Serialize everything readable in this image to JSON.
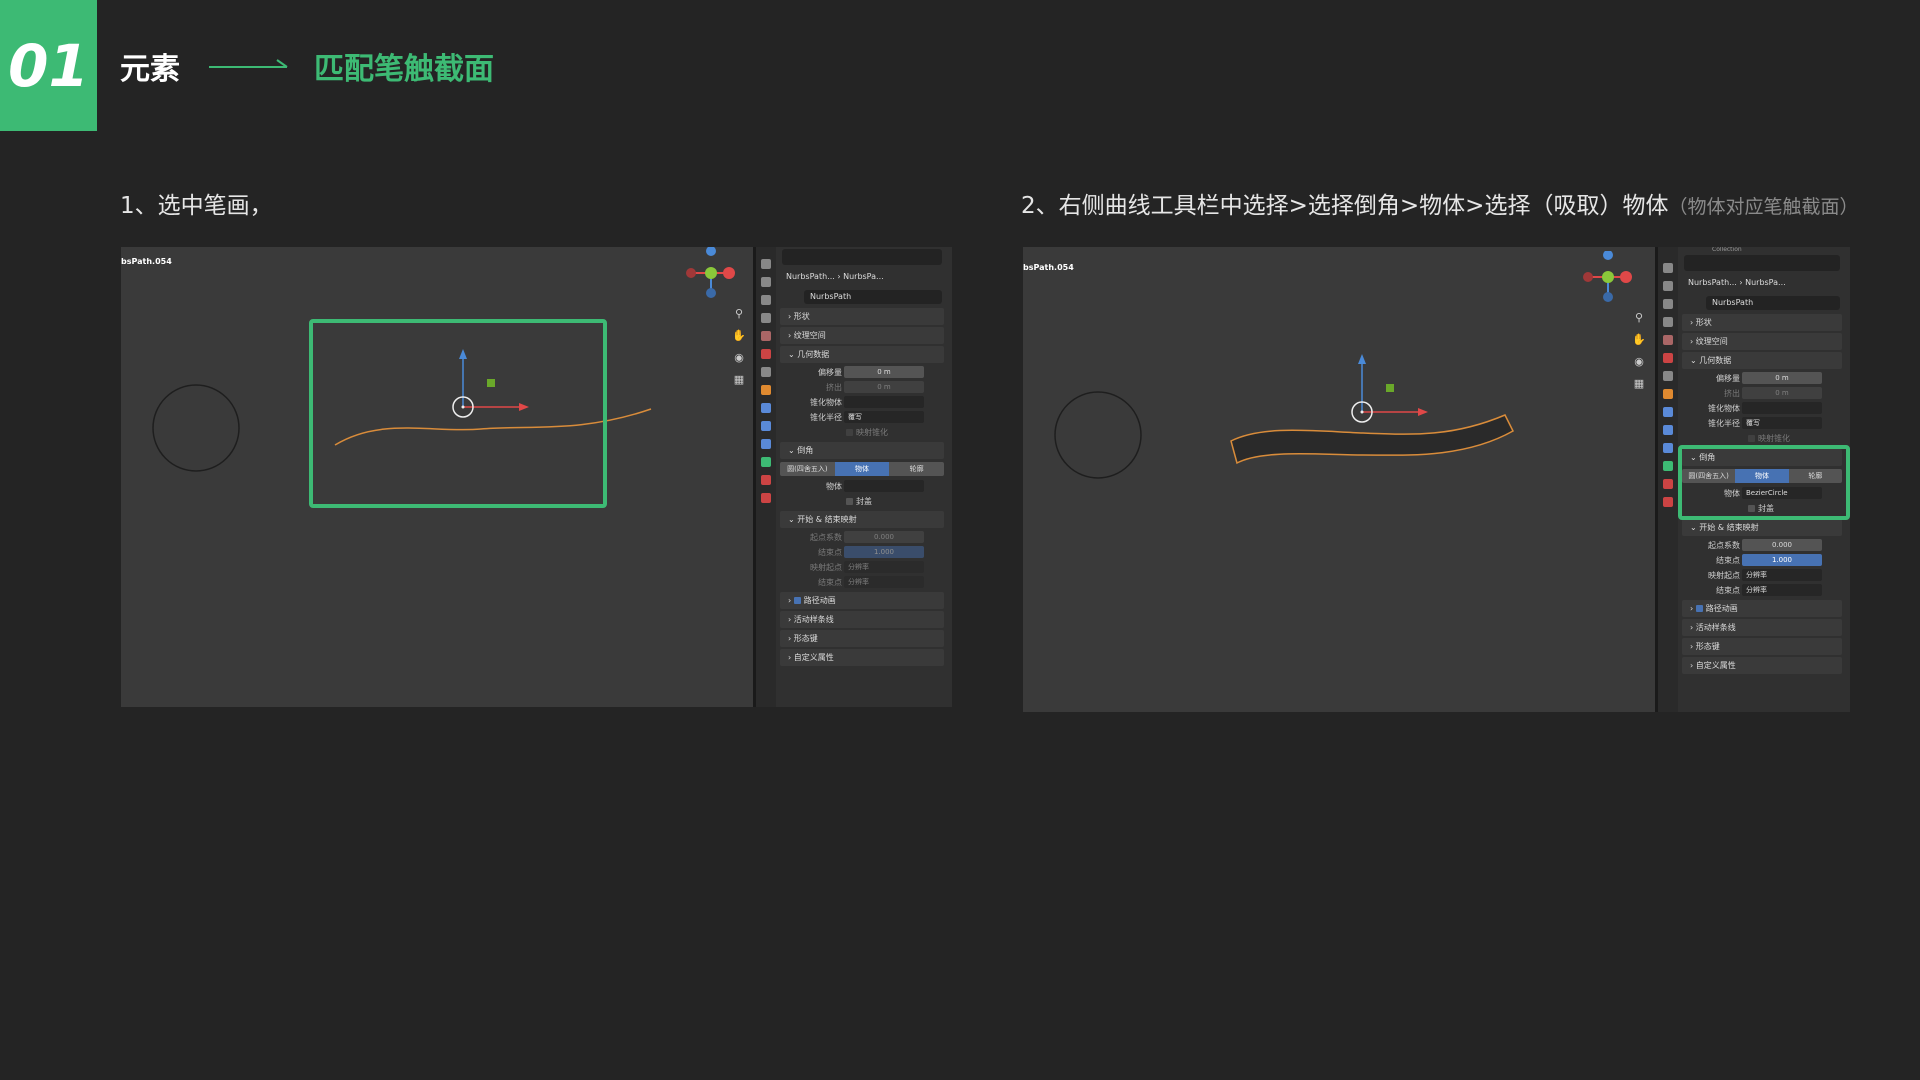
{
  "header": {
    "number": "01",
    "element_label": "元素",
    "topic": "匹配笔触截面"
  },
  "steps": {
    "step1": "1、选中笔画，",
    "step2_main": "2、右侧曲线工具栏中选择>选择倒角>物体>选择（吸取）物体",
    "step2_note": "（物体对应笔触截面）"
  },
  "shot1": {
    "object_name": "bsPath.054",
    "crumb_object": "NurbsPath...",
    "crumb_data": "NurbsPa...",
    "data_name": "NurbsPath",
    "sections": {
      "shape": "形状",
      "texture_space": "纹理空间",
      "geometry": "几何数据",
      "bevel": "倒角",
      "start_end": "开始 & 结束映射",
      "path_anim": "路径动画",
      "active_spline": "活动样条线",
      "shape_keys": "形态键",
      "custom_props": "自定义属性"
    },
    "geometry": {
      "offset_label": "偏移量",
      "offset_value": "0 m",
      "extrude_label": "挤出",
      "extrude_value": "0 m",
      "taper_label": "锥化物体",
      "taper_radius_label": "锥化半径",
      "taper_radius_value": "覆写",
      "map_taper": "映射锥化"
    },
    "bevel": {
      "mode_round": "圆(四舍五入)",
      "mode_object": "物体",
      "mode_profile": "轮廓",
      "object_label": "物体",
      "object_value": "",
      "fill_caps": "封盖"
    },
    "start_end": {
      "start_factor_label": "起点系数",
      "start_factor_value": "0.000",
      "end_factor_label": "结束点",
      "end_factor_value": "1.000",
      "mapping_start_label": "映射起点",
      "mapping_start_value": "分辨率",
      "mapping_end_label": "结束点",
      "mapping_end_value": "分辨率"
    }
  },
  "shot2": {
    "object_name": "bsPath.054",
    "collection_label": "Collection",
    "crumb_object": "NurbsPath...",
    "crumb_data": "NurbsPa...",
    "data_name": "NurbsPath",
    "sections": {
      "shape": "形状",
      "texture_space": "纹理空间",
      "geometry": "几何数据",
      "bevel": "倒角",
      "start_end": "开始 & 结束映射",
      "path_anim": "路径动画",
      "active_spline": "活动样条线",
      "shape_keys": "形态键",
      "custom_props": "自定义属性"
    },
    "geometry": {
      "offset_label": "偏移量",
      "offset_value": "0 m",
      "extrude_label": "挤出",
      "extrude_value": "0 m",
      "taper_label": "锥化物体",
      "taper_radius_label": "锥化半径",
      "taper_radius_value": "覆写",
      "map_taper": "映射锥化"
    },
    "bevel": {
      "mode_round": "圆(四舍五入)",
      "mode_object": "物体",
      "mode_profile": "轮廓",
      "object_label": "物体",
      "object_value": "BezierCircle",
      "fill_caps": "封盖"
    },
    "start_end": {
      "start_factor_label": "起点系数",
      "start_factor_value": "0.000",
      "end_factor_label": "结束点",
      "end_factor_value": "1.000",
      "mapping_start_label": "映射起点",
      "mapping_start_value": "分辨率",
      "mapping_end_label": "结束点",
      "mapping_end_value": "分辨率"
    }
  },
  "colors": {
    "accent_green": "#3dba74",
    "background": "#242424",
    "blender_blue": "#4772b3",
    "curve_orange": "#d98c3a"
  }
}
